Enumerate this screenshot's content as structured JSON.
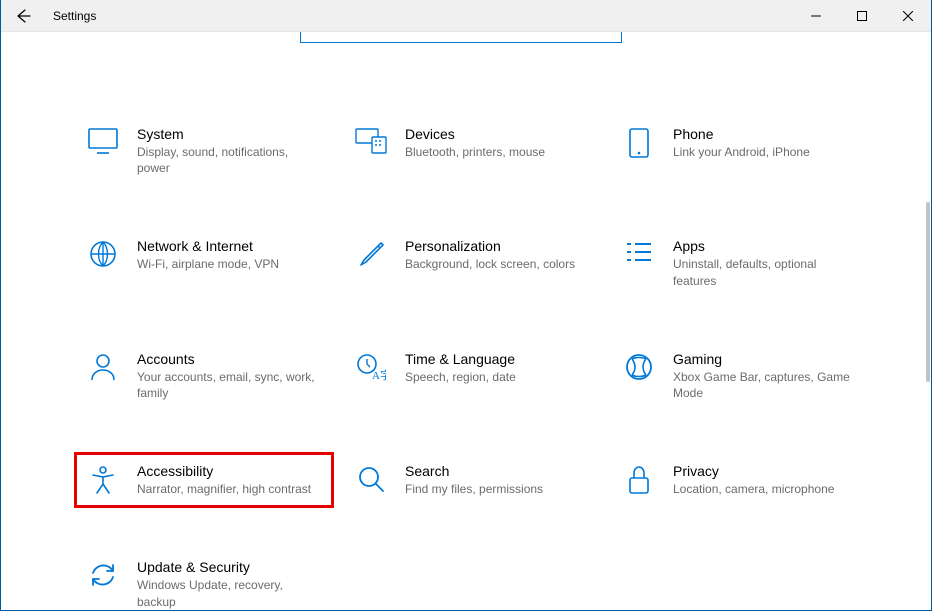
{
  "window": {
    "title": "Settings"
  },
  "tiles": {
    "system": {
      "title": "System",
      "sub": "Display, sound, notifications, power"
    },
    "devices": {
      "title": "Devices",
      "sub": "Bluetooth, printers, mouse"
    },
    "phone": {
      "title": "Phone",
      "sub": "Link your Android, iPhone"
    },
    "network": {
      "title": "Network & Internet",
      "sub": "Wi-Fi, airplane mode, VPN"
    },
    "personal": {
      "title": "Personalization",
      "sub": "Background, lock screen, colors"
    },
    "apps": {
      "title": "Apps",
      "sub": "Uninstall, defaults, optional features"
    },
    "accounts": {
      "title": "Accounts",
      "sub": "Your accounts, email, sync, work, family"
    },
    "time": {
      "title": "Time & Language",
      "sub": "Speech, region, date"
    },
    "gaming": {
      "title": "Gaming",
      "sub": "Xbox Game Bar, captures, Game Mode"
    },
    "accessibility": {
      "title": "Accessibility",
      "sub": "Narrator, magnifier, high contrast"
    },
    "search": {
      "title": "Search",
      "sub": "Find my files, permissions"
    },
    "privacy": {
      "title": "Privacy",
      "sub": "Location, camera, microphone"
    },
    "update": {
      "title": "Update & Security",
      "sub": "Windows Update, recovery, backup"
    }
  }
}
